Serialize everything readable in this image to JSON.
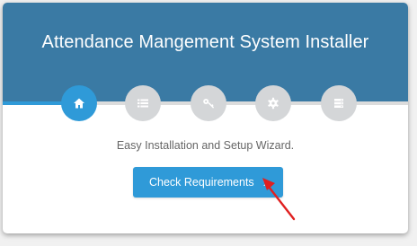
{
  "installer": {
    "title": "Attendance Mangement System Installer",
    "subtitle": "Easy Installation and Setup Wizard.",
    "button_label": "Check Requirements",
    "button_chevron": "›",
    "progress_fraction": 0.19,
    "steps": [
      {
        "icon": "home-icon",
        "state": "active"
      },
      {
        "icon": "list-icon",
        "state": "inactive"
      },
      {
        "icon": "key-icon",
        "state": "inactive"
      },
      {
        "icon": "gear-icon",
        "state": "inactive"
      },
      {
        "icon": "server-icon",
        "state": "inactive"
      }
    ]
  },
  "colors": {
    "header": "#3a7aa4",
    "accent": "#2f9ad8",
    "step_inactive": "#d4d6d8",
    "annotation_arrow": "#e02020"
  }
}
